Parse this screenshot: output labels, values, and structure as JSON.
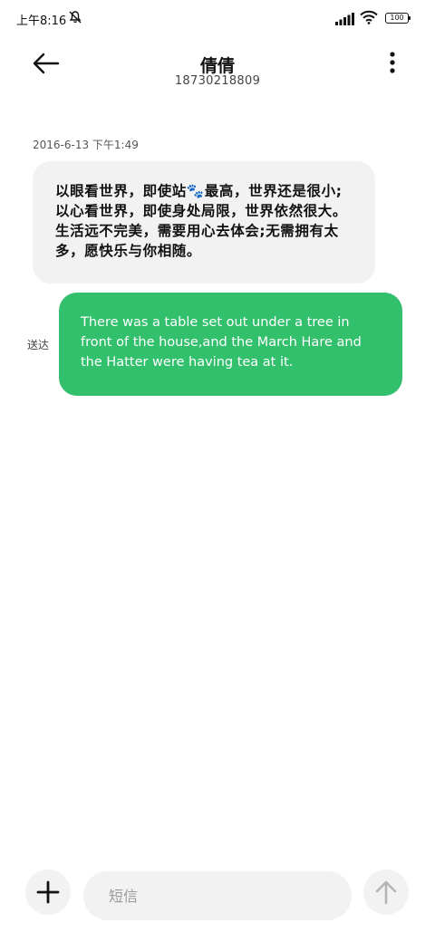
{
  "status_bar": {
    "time": "上午8:16",
    "battery_level": "100",
    "icons": [
      "mute-icon",
      "signal-icon",
      "wifi-icon",
      "battery-icon"
    ]
  },
  "header": {
    "contact_name": "倩倩",
    "phone_number": "18730218809",
    "icons": [
      "back-arrow-icon",
      "more-vertical-icon"
    ]
  },
  "conversation": {
    "timestamp": "2016-6-13 下午1:49",
    "incoming_message": "以眼看世界，即使站🐾最高，世界还是很小;以心看世界，即使身处局限，世界依然很大。生活远不完美，需要用心去体会;无需拥有太多，愿快乐与你相随。",
    "outgoing_message": "There was a table set out under a tree in front of the house,and the March Hare and the Hatter were having tea at it.",
    "delivery_status": "送达"
  },
  "composer": {
    "placeholder": "短信",
    "value": "",
    "icons": [
      "plus-icon",
      "send-arrow-icon"
    ]
  },
  "colors": {
    "outgoing_bubble": "#32c06c",
    "incoming_bubble": "#f2f2f2",
    "composer_background": "#f2f2f2",
    "background": "#ffffff"
  }
}
